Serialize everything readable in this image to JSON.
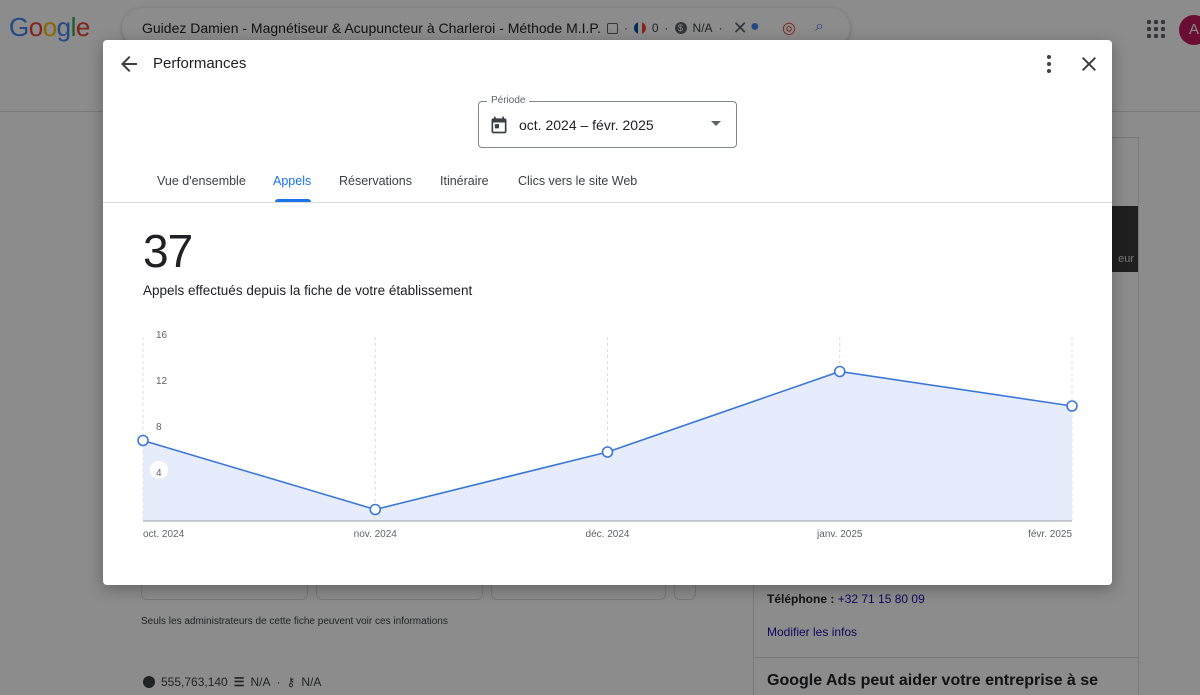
{
  "background": {
    "logo": "Google",
    "search_query": "Guidez Damien - Magnétiseur & Acupuncteur à Charleroi - Méthode M.I.P.",
    "seo_count": "0",
    "seo_na": "N/A",
    "avatar_letter": "A",
    "image_overlay_text": "eur",
    "admin_notice": "Seuls les administrateurs de cette fiche peuvent voir ces informations",
    "phone_label": "Téléphone :",
    "phone_value": "+32 71 15 80 09",
    "edit_info": "Modifier les infos",
    "ads_title": "Google Ads peut aider votre entreprise à se",
    "metric_count": "555,763,140",
    "metric_na1": "N/A",
    "metric_na2": "N/A"
  },
  "dialog": {
    "title": "Performances",
    "period": {
      "label": "Période",
      "value": "oct. 2024 – févr. 2025"
    },
    "tabs": [
      {
        "label": "Vue d'ensemble",
        "active": false
      },
      {
        "label": "Appels",
        "active": true
      },
      {
        "label": "Réservations",
        "active": false
      },
      {
        "label": "Itinéraire",
        "active": false
      },
      {
        "label": "Clics vers le site Web",
        "active": false
      }
    ],
    "total": "37",
    "caption": "Appels effectués depuis la fiche de votre établissement"
  },
  "colors": {
    "accent": "#1a73e8",
    "line": "#3c78d8",
    "area": "#e6ecfb"
  },
  "chart_data": {
    "type": "area",
    "x": [
      "oct. 2024",
      "nov. 2024",
      "déc. 2024",
      "janv. 2025",
      "févr. 2025"
    ],
    "values": [
      7,
      1,
      6,
      13,
      10
    ],
    "yticks": [
      4,
      8,
      12,
      16
    ],
    "ylim": [
      0,
      16
    ],
    "grid": "vertical dashed"
  }
}
